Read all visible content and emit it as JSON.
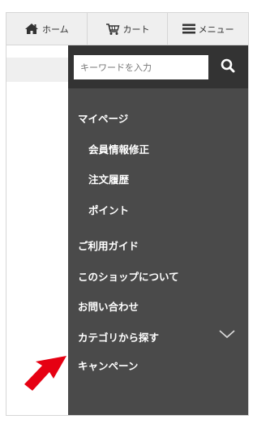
{
  "topnav": {
    "home_label": "ホーム",
    "cart_label": "カート",
    "menu_label": "メニュー"
  },
  "search": {
    "placeholder": "キーワードを入力"
  },
  "menu": {
    "mypage": "マイページ",
    "member_edit": "会員情報修正",
    "order_history": "注文履歴",
    "points": "ポイント",
    "guide": "ご利用ガイド",
    "about_shop": "このショップについて",
    "contact": "お問い合わせ",
    "category": "カテゴリから探す",
    "campaign": "キャンペーン"
  },
  "colors": {
    "drawer_bg": "#4a4a4a",
    "search_bg": "#333333",
    "nav_bg": "#efefef",
    "arrow": "#e60012"
  },
  "icons": {
    "home": "home-icon",
    "cart": "cart-icon",
    "menu": "hamburger-icon",
    "search": "search-icon",
    "category_expand": "chevron-down-icon",
    "pointer": "red-arrow-icon"
  }
}
